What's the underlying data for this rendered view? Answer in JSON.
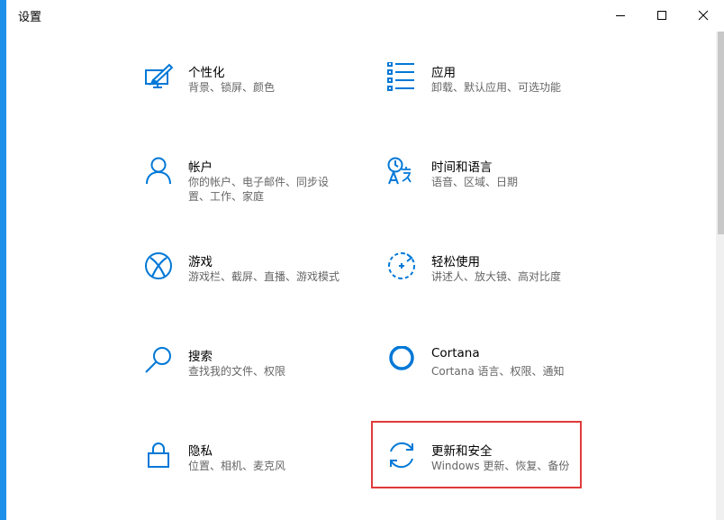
{
  "window": {
    "title": "设置"
  },
  "controls": {
    "minimize_icon": "minimize-icon",
    "maximize_icon": "maximize-icon",
    "close_icon": "close-icon"
  },
  "accent_color": "#0078d7",
  "highlight_color": "#e03a3a",
  "tiles": {
    "personalization": {
      "icon": "personalization-icon",
      "name": "个性化",
      "desc1": "背景、锁屏、颜色",
      "desc2": ""
    },
    "apps": {
      "icon": "apps-icon",
      "name": "应用",
      "desc1": "卸载、默认应用、可选功能",
      "desc2": ""
    },
    "accounts": {
      "icon": "account-icon",
      "name": "帐户",
      "desc1": "你的帐户、电子邮件、同步设",
      "desc2": "置、工作、家庭"
    },
    "time_language": {
      "icon": "time-language-icon",
      "name": "时间和语言",
      "desc1": "语音、区域、日期",
      "desc2": ""
    },
    "gaming": {
      "icon": "xbox-icon",
      "name": "游戏",
      "desc1": "游戏栏、截屏、直播、游戏模式",
      "desc2": ""
    },
    "ease_of_access": {
      "icon": "ease-of-access-icon",
      "name": "轻松使用",
      "desc1": "讲述人、放大镜、高对比度",
      "desc2": ""
    },
    "search": {
      "icon": "search-icon",
      "name": "搜索",
      "desc1": "查找我的文件、权限",
      "desc2": ""
    },
    "cortana": {
      "icon": "cortana-icon",
      "name": "Cortana",
      "desc1": "Cortana 语言、权限、通知",
      "desc2": ""
    },
    "privacy": {
      "icon": "lock-icon",
      "name": "隐私",
      "desc1": "位置、相机、麦克风",
      "desc2": ""
    },
    "update_security": {
      "icon": "sync-icon",
      "name": "更新和安全",
      "desc1": "Windows 更新、恢复、备份",
      "desc2": ""
    }
  }
}
